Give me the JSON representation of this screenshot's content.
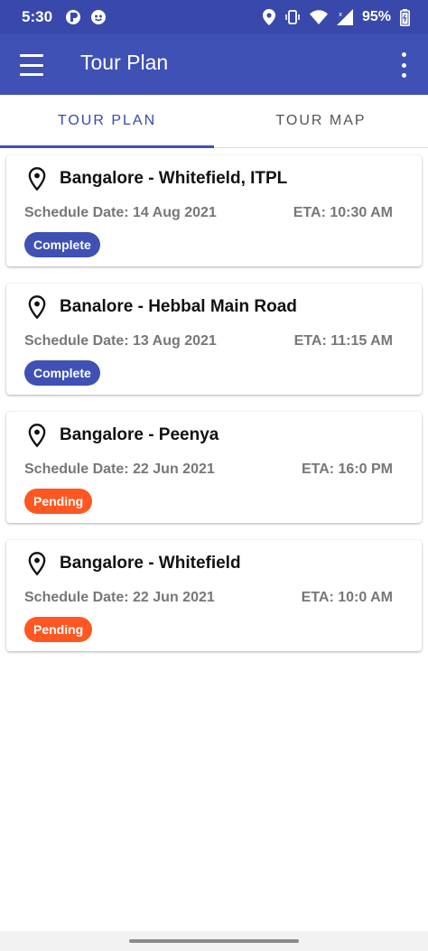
{
  "status_bar": {
    "time": "5:30",
    "battery_percent": "95%",
    "icons": [
      "location-icon",
      "vibrate-icon",
      "wifi-icon",
      "signal-icon",
      "battery-icon"
    ]
  },
  "app_bar": {
    "title": "Tour Plan",
    "menu_icon": "hamburger-menu-icon",
    "more_icon": "more-vertical-icon"
  },
  "tabs": [
    {
      "label": "TOUR PLAN",
      "active": true
    },
    {
      "label": "TOUR MAP",
      "active": false
    }
  ],
  "colors": {
    "primary": "#3f51b5",
    "status_bar": "#3949ab",
    "complete": "#3f51b5",
    "pending": "#ff5722"
  },
  "tours": [
    {
      "title": "Bangalore - Whitefield, ITPL",
      "date": "Schedule Date: 14 Aug 2021",
      "eta": "ETA: 10:30 AM",
      "status": "Complete"
    },
    {
      "title": "Banalore - Hebbal Main Road",
      "date": "Schedule Date: 13 Aug 2021",
      "eta": "ETA: 11:15 AM",
      "status": "Complete"
    },
    {
      "title": "Bangalore - Peenya",
      "date": "Schedule Date: 22 Jun 2021",
      "eta": "ETA: 16:0 PM",
      "status": "Pending"
    },
    {
      "title": "Bangalore - Whitefield",
      "date": "Schedule Date: 22 Jun 2021",
      "eta": "ETA: 10:0 AM",
      "status": "Pending"
    }
  ]
}
